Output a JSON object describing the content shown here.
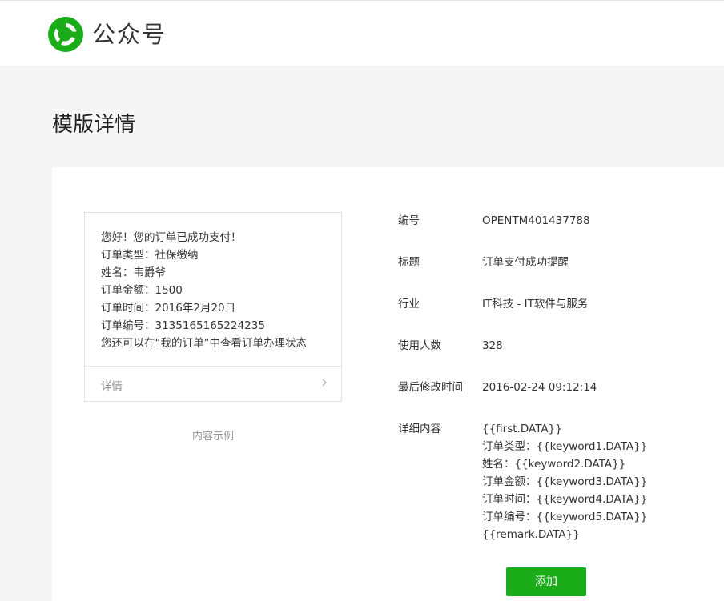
{
  "header": {
    "logo_icon": "wechat-official-account-logo",
    "brand_color": "#1aad19",
    "title": "公众号"
  },
  "page": {
    "title": "模版详情"
  },
  "preview": {
    "lines": [
      "您好！您的订单已成功支付！",
      "订单类型：社保缴纳",
      "姓名：韦爵爷",
      "订单金额：1500",
      "订单时间：2016年2月20日",
      "订单编号：3135165165224235",
      "您还可以在“我的订单”中查看订单办理状态"
    ],
    "footer_label": "详情",
    "footer_icon": "chevron-right-icon",
    "caption": "内容示例"
  },
  "info": {
    "id": {
      "label": "编号",
      "value": "OPENTM401437788"
    },
    "title": {
      "label": "标题",
      "value": "订单支付成功提醒"
    },
    "industry": {
      "label": "行业",
      "value": "IT科技 - IT软件与服务"
    },
    "users": {
      "label": "使用人数",
      "value": "328"
    },
    "modified": {
      "label": "最后修改时间",
      "value": "2016-02-24 09:12:14"
    },
    "detail": {
      "label": "详细内容",
      "lines": [
        "{{first.DATA}}",
        "订单类型：{{keyword1.DATA}}",
        "姓名：{{keyword2.DATA}}",
        "订单金额：{{keyword3.DATA}}",
        "订单时间：{{keyword4.DATA}}",
        "订单编号：{{keyword5.DATA}}",
        "{{remark.DATA}}"
      ]
    }
  },
  "actions": {
    "add_label": "添加"
  }
}
